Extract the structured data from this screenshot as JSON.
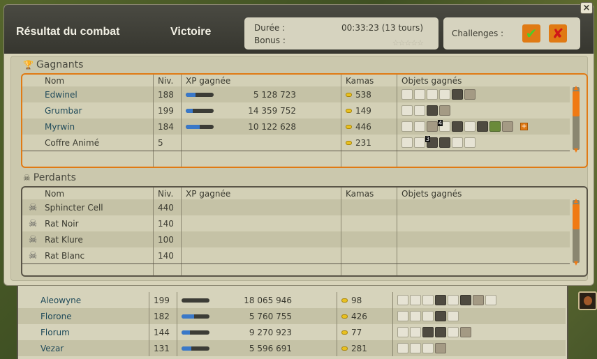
{
  "window": {
    "title": "Résultat du combat",
    "result": "Victoire",
    "duration_label": "Durée :",
    "duration_value": "00:33:23 (13 tours)",
    "bonus_label": "Bonus :",
    "bonus_stars": "☆☆☆☆☆",
    "challenges_label": "Challenges :",
    "close_glyph": "×",
    "challenge_success_glyph": "✔",
    "challenge_fail_glyph": "✘"
  },
  "colors": {
    "winners_border": "#e07a14",
    "losers_border": "#5a5548",
    "xp_fill": "#3a78c8",
    "accent": "#f07a14"
  },
  "columns": {
    "name": "Nom",
    "level": "Niv.",
    "xp": "XP gagnée",
    "kamas": "Kamas",
    "items": "Objets gagnés"
  },
  "winners": {
    "label": "Gagnants",
    "rows": [
      {
        "name": "Edwinel",
        "level": "188",
        "xp": "5 128 723",
        "xp_progress": 0.35,
        "kamas": "538",
        "items": [
          "light",
          "light",
          "light",
          "light",
          "dark",
          "tan"
        ]
      },
      {
        "name": "Grumbar",
        "level": "199",
        "xp": "14 359 752",
        "xp_progress": 0.25,
        "kamas": "149",
        "items": [
          "light",
          "light",
          "dark",
          "tan"
        ]
      },
      {
        "name": "Myrwin",
        "level": "184",
        "xp": "10 122 628",
        "xp_progress": 0.5,
        "kamas": "446",
        "items": [
          "light",
          "light",
          "tan",
          "light",
          "dark",
          "light",
          "dark",
          "green",
          "tan"
        ],
        "item_qty": "4",
        "has_more": true,
        "more_glyph": "+"
      },
      {
        "name": "Coffre Animé",
        "level": "5",
        "xp": "",
        "kamas": "231",
        "items": [
          "light",
          "light",
          "dark",
          "dark",
          "light",
          "light"
        ],
        "item_qty": "3"
      }
    ]
  },
  "losers": {
    "label": "Perdants",
    "rows": [
      {
        "name": "Sphincter Cell",
        "level": "440"
      },
      {
        "name": "Rat Noir",
        "level": "140"
      },
      {
        "name": "Rat Klure",
        "level": "100"
      },
      {
        "name": "Rat Blanc",
        "level": "140"
      }
    ]
  },
  "background_table": {
    "rows": [
      {
        "name": "Aleowyne",
        "level": "199",
        "xp": "18 065 946",
        "xp_progress": 0.0,
        "kamas": "98"
      },
      {
        "name": "Florone",
        "level": "182",
        "xp": "5 760 755",
        "xp_progress": 0.45,
        "kamas": "426"
      },
      {
        "name": "Florum",
        "level": "144",
        "xp": "9 270 923",
        "xp_progress": 0.3,
        "kamas": "77"
      },
      {
        "name": "Vezar",
        "level": "131",
        "xp": "5 596 691",
        "xp_progress": 0.35,
        "kamas": "281"
      }
    ]
  }
}
